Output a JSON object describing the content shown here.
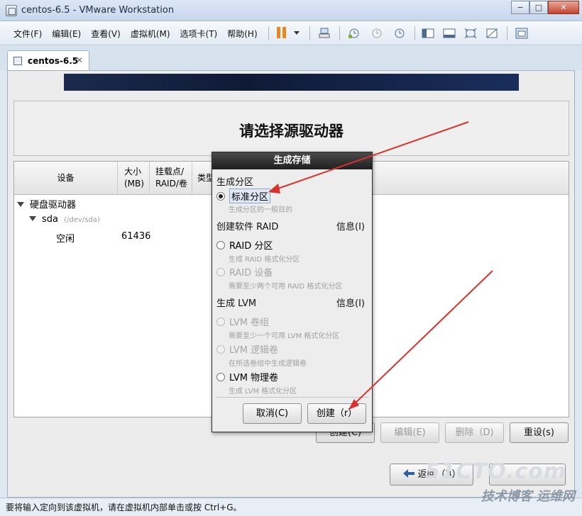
{
  "window": {
    "title": "centos-6.5 - VMware Workstation"
  },
  "window_buttons": {
    "minimize": "−",
    "restore": "□",
    "close": "✕"
  },
  "menu": [
    {
      "label": "文件(F)"
    },
    {
      "label": "编辑(E)"
    },
    {
      "label": "查看(V)"
    },
    {
      "label": "虚拟机(M)"
    },
    {
      "label": "选项卡(T)"
    },
    {
      "label": "帮助(H)"
    }
  ],
  "tab": {
    "label": "centos-6.5",
    "close": "✕"
  },
  "installer": {
    "title": "请选择源驱动器",
    "columns": {
      "device": "设备",
      "size": "大小\n(MB)",
      "mount": "挂载点/\nRAID/卷",
      "type": "类型"
    },
    "tree": {
      "group": "硬盘驱动器",
      "disk": "sda",
      "disk_path": "(/dev/sda)",
      "free_label": "空闲",
      "free_size": "61436"
    },
    "buttons": {
      "create": "创建(C)",
      "edit": "编辑(E)",
      "delete": "删除（D)",
      "reset": "重设(s)",
      "back": "返回（B）"
    }
  },
  "dialog": {
    "title": "生成存储",
    "section1": "生成分区",
    "std_partition": "标准分区",
    "std_partition_desc": "生成分区的一般目的",
    "section2": "创建软件 RAID",
    "info1": "信息(I)",
    "raid_partition": "RAID 分区",
    "raid_partition_desc": "生成 RAID 格式化分区",
    "raid_device": "RAID 设备",
    "raid_device_desc": "需要至少两个可用 RAID 格式化分区",
    "section3": "生成 LVM",
    "info2": "信息(I)",
    "lvm_vg": "LVM 卷组",
    "lvm_vg_desc": "需要至少一个可用 LVM 格式化分区",
    "lvm_lv": "LVM 逻辑卷",
    "lvm_lv_desc": "在所选卷组中生成逻辑卷",
    "lvm_pv": "LVM 物理卷",
    "lvm_pv_desc": "生成 LVM 格式化分区",
    "cancel": "取消(C)",
    "create": "创建（r）"
  },
  "status_bar": {
    "text": "要将输入定向到该虚拟机，请在虚拟机内部单击或按 Ctrl+G。"
  },
  "watermark": {
    "line1": "51CTO.com",
    "line2": "技术博客  运维网"
  },
  "colors": {
    "accent_arrow": "#d9322a",
    "dialog_title_bg": "#2a2a2a",
    "banner": "#13204a"
  }
}
